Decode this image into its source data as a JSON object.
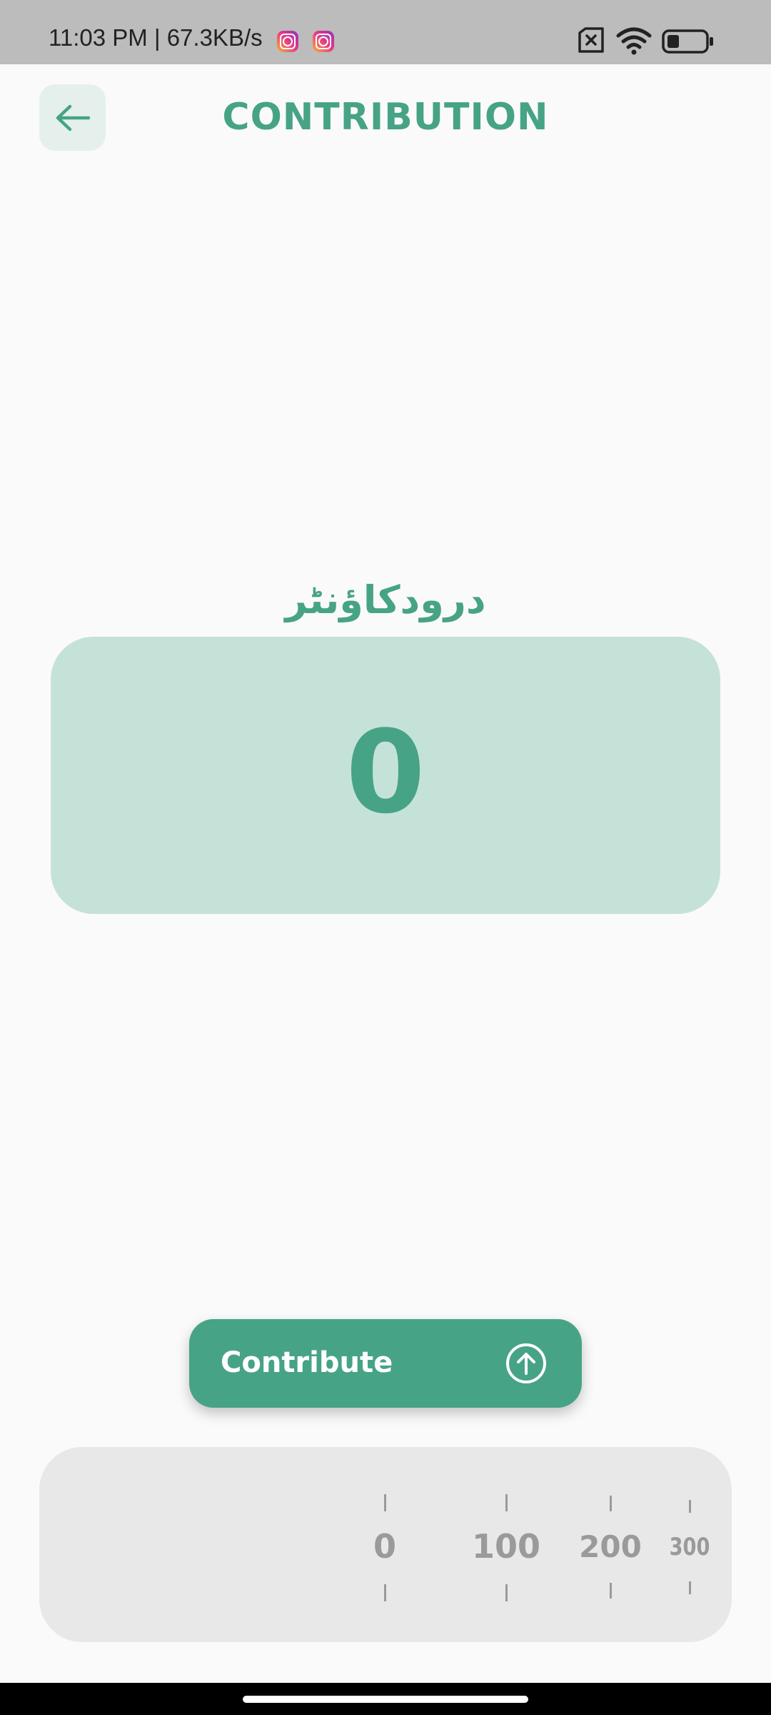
{
  "status_bar": {
    "time_speed": "11:03 PM | 67.3KB/s",
    "icons": [
      "instagram-icon",
      "instagram-icon",
      "sim-off-icon",
      "wifi-icon",
      "battery-icon"
    ]
  },
  "header": {
    "title": "CONTRIBUTION",
    "back_icon": "arrow-left-icon"
  },
  "counter": {
    "label": "درودکاؤنٹر",
    "value": "0"
  },
  "contribute_button": {
    "label": "Contribute",
    "icon": "arrow-up-circle-icon"
  },
  "slider": {
    "ticks": [
      "0",
      "100",
      "200",
      "300"
    ],
    "selected": "0"
  },
  "colors": {
    "accent": "#47a386",
    "card": "#c5e2d9",
    "panel": "#e8e8e8"
  }
}
